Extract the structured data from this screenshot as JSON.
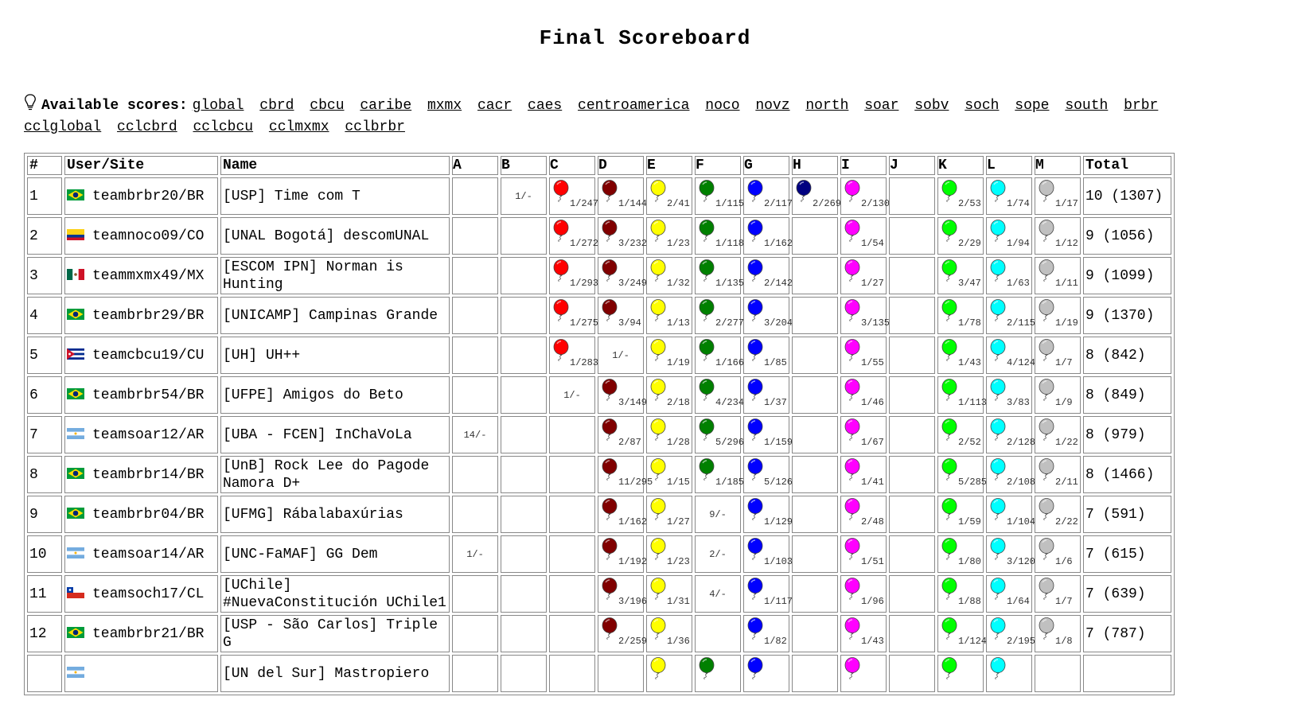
{
  "title": "Final Scoreboard",
  "scores_label": "Available scores:",
  "score_links": [
    "global",
    "cbrd",
    "cbcu",
    "caribe",
    "mxmx",
    "cacr",
    "caes",
    "centroamerica",
    "noco",
    "novz",
    "north",
    "soar",
    "sobv",
    "soch",
    "sope",
    "south",
    "brbr",
    "cclglobal",
    "cclcbrd",
    "cclcbcu",
    "cclmxmx",
    "cclbrbr"
  ],
  "headers": [
    "#",
    "User/Site",
    "Name",
    "A",
    "B",
    "C",
    "D",
    "E",
    "F",
    "G",
    "H",
    "I",
    "J",
    "K",
    "L",
    "M",
    "Total"
  ],
  "colors": {
    "C": "#ff0000",
    "D": "#800000",
    "E": "#ffff00",
    "F": "#008000",
    "G": "#0000ff",
    "H": "#000080",
    "I": "#ff00ff",
    "K": "#00ff00",
    "L": "#00ffff",
    "M": "#c0c0c0"
  },
  "rows": [
    {
      "rank": "1",
      "site": "teambrbr20/BR",
      "flag": "BR",
      "name": "[USP] Time com T",
      "total": "10 (1307)",
      "cells": [
        null,
        {
          "t": "1/-",
          "s": false
        },
        {
          "t": "1/247",
          "s": true
        },
        {
          "t": "1/144",
          "s": true
        },
        {
          "t": "2/41",
          "s": true
        },
        {
          "t": "1/115",
          "s": true
        },
        {
          "t": "2/117",
          "s": true
        },
        {
          "t": "2/269",
          "s": true
        },
        {
          "t": "2/130",
          "s": true
        },
        null,
        {
          "t": "2/53",
          "s": true
        },
        {
          "t": "1/74",
          "s": true
        },
        {
          "t": "1/17",
          "s": true
        }
      ]
    },
    {
      "rank": "2",
      "site": "teamnoco09/CO",
      "flag": "CO",
      "name": "[UNAL Bogotá] descomUNAL",
      "total": "9 (1056)",
      "cells": [
        null,
        null,
        {
          "t": "1/272",
          "s": true
        },
        {
          "t": "3/232",
          "s": true
        },
        {
          "t": "1/23",
          "s": true
        },
        {
          "t": "1/118",
          "s": true
        },
        {
          "t": "1/162",
          "s": true
        },
        null,
        {
          "t": "1/54",
          "s": true
        },
        null,
        {
          "t": "2/29",
          "s": true
        },
        {
          "t": "1/94",
          "s": true
        },
        {
          "t": "1/12",
          "s": true
        }
      ]
    },
    {
      "rank": "3",
      "site": "teammxmx49/MX",
      "flag": "MX",
      "name": "[ESCOM IPN] Norman is Hunting",
      "total": "9 (1099)",
      "cells": [
        null,
        null,
        {
          "t": "1/293",
          "s": true
        },
        {
          "t": "3/249",
          "s": true
        },
        {
          "t": "1/32",
          "s": true
        },
        {
          "t": "1/135",
          "s": true
        },
        {
          "t": "2/142",
          "s": true
        },
        null,
        {
          "t": "1/27",
          "s": true
        },
        null,
        {
          "t": "3/47",
          "s": true
        },
        {
          "t": "1/63",
          "s": true
        },
        {
          "t": "1/11",
          "s": true
        }
      ]
    },
    {
      "rank": "4",
      "site": "teambrbr29/BR",
      "flag": "BR",
      "name": "[UNICAMP] Campinas Grande",
      "total": "9 (1370)",
      "cells": [
        null,
        null,
        {
          "t": "1/275",
          "s": true
        },
        {
          "t": "3/94",
          "s": true
        },
        {
          "t": "1/13",
          "s": true
        },
        {
          "t": "2/277",
          "s": true
        },
        {
          "t": "3/204",
          "s": true
        },
        null,
        {
          "t": "3/135",
          "s": true
        },
        null,
        {
          "t": "1/78",
          "s": true
        },
        {
          "t": "2/115",
          "s": true
        },
        {
          "t": "1/19",
          "s": true
        }
      ]
    },
    {
      "rank": "5",
      "site": "teamcbcu19/CU",
      "flag": "CU",
      "name": "[UH] UH++",
      "total": "8 (842)",
      "cells": [
        null,
        null,
        {
          "t": "1/283",
          "s": true
        },
        {
          "t": "1/-",
          "s": false
        },
        {
          "t": "1/19",
          "s": true
        },
        {
          "t": "1/166",
          "s": true
        },
        {
          "t": "1/85",
          "s": true
        },
        null,
        {
          "t": "1/55",
          "s": true
        },
        null,
        {
          "t": "1/43",
          "s": true
        },
        {
          "t": "4/124",
          "s": true
        },
        {
          "t": "1/7",
          "s": true
        }
      ]
    },
    {
      "rank": "6",
      "site": "teambrbr54/BR",
      "flag": "BR",
      "name": "[UFPE] Amigos do Beto",
      "total": "8 (849)",
      "cells": [
        null,
        null,
        {
          "t": "1/-",
          "s": false
        },
        {
          "t": "3/149",
          "s": true
        },
        {
          "t": "2/18",
          "s": true
        },
        {
          "t": "4/234",
          "s": true
        },
        {
          "t": "1/37",
          "s": true
        },
        null,
        {
          "t": "1/46",
          "s": true
        },
        null,
        {
          "t": "1/113",
          "s": true
        },
        {
          "t": "3/83",
          "s": true
        },
        {
          "t": "1/9",
          "s": true
        }
      ]
    },
    {
      "rank": "7",
      "site": "teamsoar12/AR",
      "flag": "AR",
      "name": "[UBA - FCEN] InChaVoLa",
      "total": "8 (979)",
      "cells": [
        {
          "t": "14/-",
          "s": false
        },
        null,
        null,
        {
          "t": "2/87",
          "s": true
        },
        {
          "t": "1/28",
          "s": true
        },
        {
          "t": "5/296",
          "s": true
        },
        {
          "t": "1/159",
          "s": true
        },
        null,
        {
          "t": "1/67",
          "s": true
        },
        null,
        {
          "t": "2/52",
          "s": true
        },
        {
          "t": "2/128",
          "s": true
        },
        {
          "t": "1/22",
          "s": true
        }
      ]
    },
    {
      "rank": "8",
      "site": "teambrbr14/BR",
      "flag": "BR",
      "name": "[UnB] Rock Lee do Pagode Namora D+",
      "total": "8 (1466)",
      "cells": [
        null,
        null,
        null,
        {
          "t": "11/295",
          "s": true
        },
        {
          "t": "1/15",
          "s": true
        },
        {
          "t": "1/185",
          "s": true
        },
        {
          "t": "5/126",
          "s": true
        },
        null,
        {
          "t": "1/41",
          "s": true
        },
        null,
        {
          "t": "5/285",
          "s": true
        },
        {
          "t": "2/108",
          "s": true
        },
        {
          "t": "2/11",
          "s": true
        }
      ]
    },
    {
      "rank": "9",
      "site": "teambrbr04/BR",
      "flag": "BR",
      "name": "[UFMG] Rábalabaxúrias",
      "total": "7 (591)",
      "cells": [
        null,
        null,
        null,
        {
          "t": "1/162",
          "s": true
        },
        {
          "t": "1/27",
          "s": true
        },
        {
          "t": "9/-",
          "s": false
        },
        {
          "t": "1/129",
          "s": true
        },
        null,
        {
          "t": "2/48",
          "s": true
        },
        null,
        {
          "t": "1/59",
          "s": true
        },
        {
          "t": "1/104",
          "s": true
        },
        {
          "t": "2/22",
          "s": true
        }
      ]
    },
    {
      "rank": "10",
      "site": "teamsoar14/AR",
      "flag": "AR",
      "name": "[UNC-FaMAF] GG Dem",
      "total": "7 (615)",
      "cells": [
        {
          "t": "1/-",
          "s": false
        },
        null,
        null,
        {
          "t": "1/192",
          "s": true
        },
        {
          "t": "1/23",
          "s": true
        },
        {
          "t": "2/-",
          "s": false
        },
        {
          "t": "1/103",
          "s": true
        },
        null,
        {
          "t": "1/51",
          "s": true
        },
        null,
        {
          "t": "1/80",
          "s": true
        },
        {
          "t": "3/120",
          "s": true
        },
        {
          "t": "1/6",
          "s": true
        }
      ]
    },
    {
      "rank": "11",
      "site": "teamsoch17/CL",
      "flag": "CL",
      "name": "[UChile] #NuevaConstitución UChile1",
      "total": "7 (639)",
      "cells": [
        null,
        null,
        null,
        {
          "t": "3/196",
          "s": true
        },
        {
          "t": "1/31",
          "s": true
        },
        {
          "t": "4/-",
          "s": false
        },
        {
          "t": "1/117",
          "s": true
        },
        null,
        {
          "t": "1/96",
          "s": true
        },
        null,
        {
          "t": "1/88",
          "s": true
        },
        {
          "t": "1/64",
          "s": true
        },
        {
          "t": "1/7",
          "s": true
        }
      ]
    },
    {
      "rank": "12",
      "site": "teambrbr21/BR",
      "flag": "BR",
      "name": "[USP - São Carlos] Triple G",
      "total": "7 (787)",
      "cells": [
        null,
        null,
        null,
        {
          "t": "2/259",
          "s": true
        },
        {
          "t": "1/36",
          "s": true
        },
        null,
        {
          "t": "1/82",
          "s": true
        },
        null,
        {
          "t": "1/43",
          "s": true
        },
        null,
        {
          "t": "1/124",
          "s": true
        },
        {
          "t": "2/195",
          "s": true
        },
        {
          "t": "1/8",
          "s": true
        }
      ]
    },
    {
      "rank": "",
      "site": "",
      "flag": "AR",
      "name": "[UN del Sur] Mastropiero",
      "total": "",
      "cells": [
        null,
        null,
        null,
        null,
        {
          "t": "",
          "s": true
        },
        {
          "t": "",
          "s": true
        },
        {
          "t": "",
          "s": true
        },
        null,
        {
          "t": "",
          "s": true
        },
        null,
        {
          "t": "",
          "s": true
        },
        {
          "t": "",
          "s": true
        },
        null
      ]
    }
  ]
}
